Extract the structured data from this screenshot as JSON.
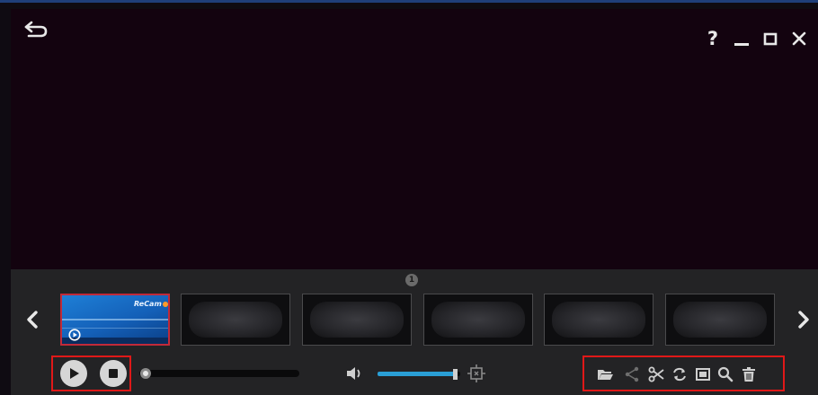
{
  "window": {
    "controls": {
      "help_label": "?"
    }
  },
  "gallery": {
    "page_number": "1",
    "thumbnail_logo_text": "ReCam"
  },
  "player": {
    "progress_fraction": 0.0,
    "volume_fraction": 0.95
  },
  "icons": {
    "back": "back-arrow-icon",
    "help": "help-icon",
    "minimize": "minimize-icon",
    "maximize": "maximize-icon",
    "close": "close-icon",
    "prev": "chevron-left-icon",
    "next": "chevron-right-icon",
    "play": "play-icon",
    "stop": "stop-icon",
    "volume": "speaker-icon",
    "fit": "fit-screen-icon",
    "tools": [
      "folder-open-icon",
      "share-icon",
      "scissors-icon",
      "convert-icon",
      "gallery-icon",
      "search-icon",
      "trash-icon"
    ]
  },
  "colors": {
    "accent": "#2a9fd6",
    "highlight_box": "#e01818",
    "selected_border": "#c02a3a"
  }
}
